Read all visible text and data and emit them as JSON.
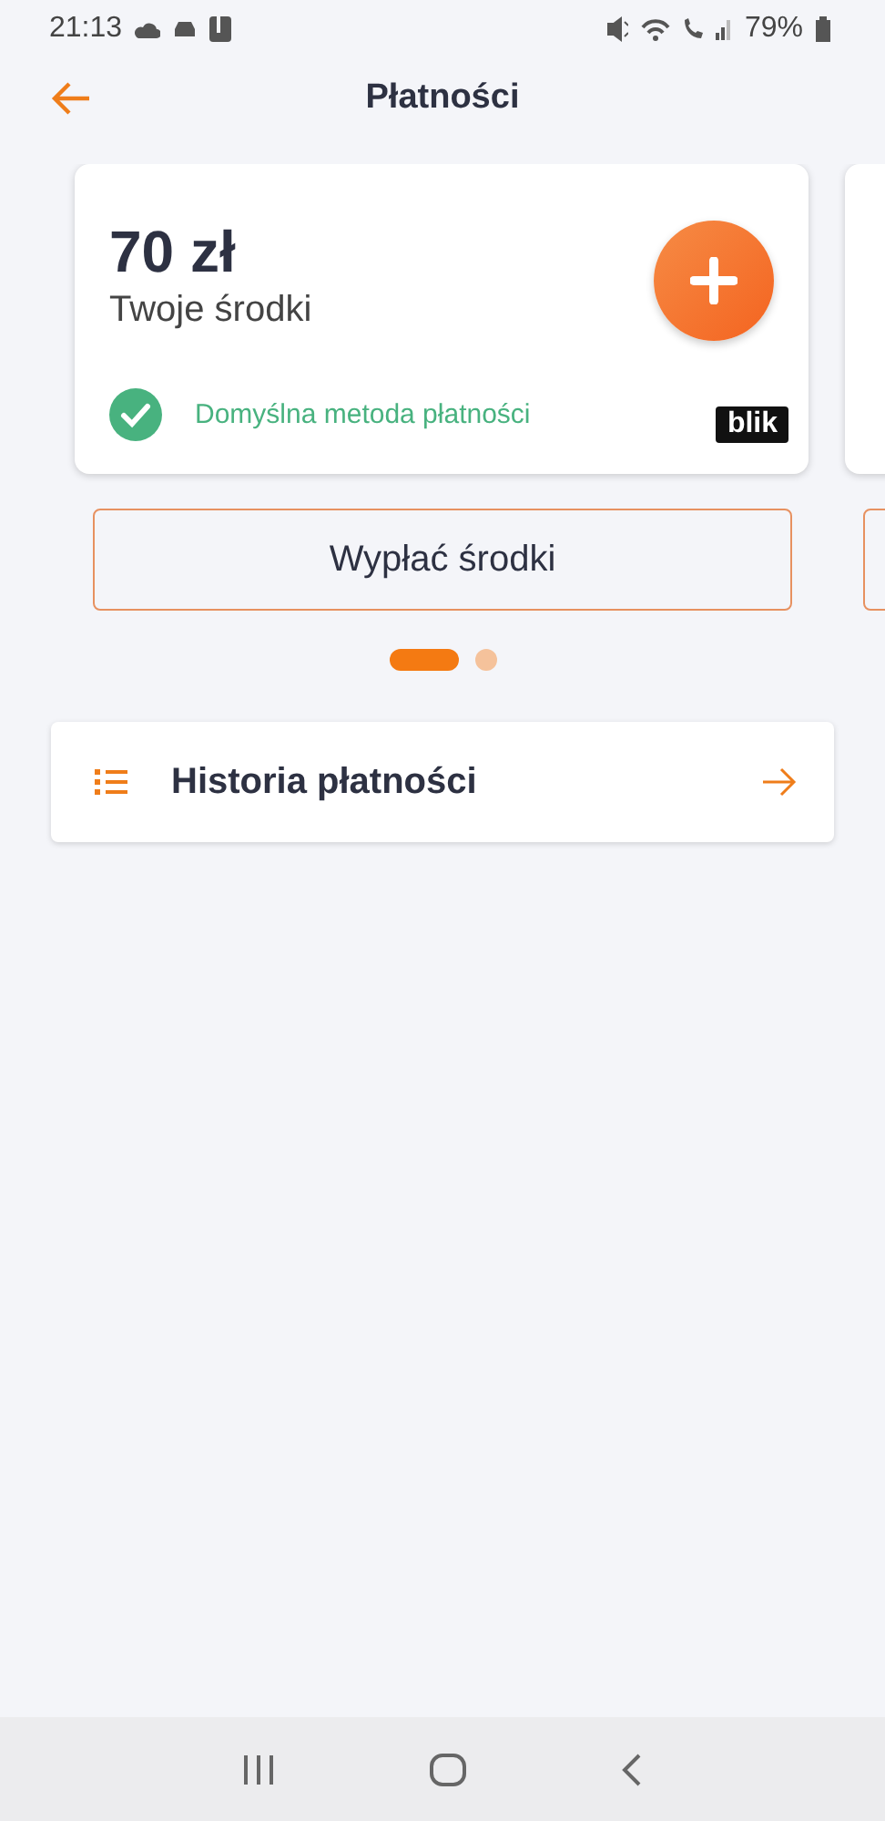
{
  "status_bar": {
    "time": "21:13",
    "battery": "79%"
  },
  "header": {
    "title": "Płatności"
  },
  "wallets": [
    {
      "amount": "70 zł",
      "label": "Twoje środki",
      "default_text": "Domyślna metoda płatności",
      "logo": "blik",
      "button": "Wypłać środki"
    },
    {
      "kind": "partial"
    }
  ],
  "pager": [
    {
      "selected": true
    },
    {
      "selected": false
    }
  ],
  "menu": [
    {
      "label": "Historia płatności"
    }
  ]
}
